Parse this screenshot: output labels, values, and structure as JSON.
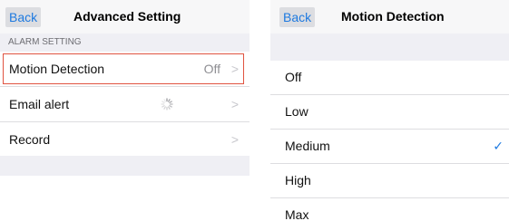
{
  "left_screen": {
    "back_label": "Back",
    "title": "Advanced Setting",
    "section_header": "ALARM SETTING",
    "rows": [
      {
        "label": "Motion Detection",
        "value": "Off",
        "chevron": ">"
      },
      {
        "label": "Email alert",
        "value": "",
        "chevron": ">"
      },
      {
        "label": "Record",
        "value": "",
        "chevron": ">"
      }
    ]
  },
  "right_screen": {
    "back_label": "Back",
    "title": "Motion Detection",
    "options": [
      {
        "label": "Off"
      },
      {
        "label": "Low"
      },
      {
        "label": "Medium",
        "check": "✓"
      },
      {
        "label": "High"
      },
      {
        "label": "Max"
      }
    ],
    "selected": "Medium"
  },
  "colors": {
    "accent": "#1e7ae0",
    "highlight_border": "#e05340",
    "group_background": "#efeff4",
    "secondary_text": "#8e8e93"
  }
}
